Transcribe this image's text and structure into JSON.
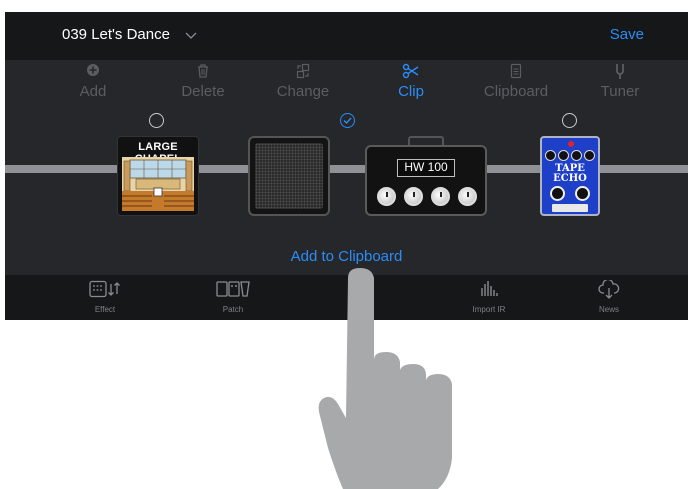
{
  "header": {
    "patch_name": "039 Let's Dance",
    "save_label": "Save"
  },
  "toolbar": {
    "items": [
      {
        "label": "Add",
        "icon": "plus-circle-icon",
        "active": false
      },
      {
        "label": "Delete",
        "icon": "trash-icon",
        "active": false
      },
      {
        "label": "Change",
        "icon": "swap-icon",
        "active": false
      },
      {
        "label": "Clip",
        "icon": "scissors-icon",
        "active": true
      },
      {
        "label": "Clipboard",
        "icon": "clipboard-icon",
        "active": false
      },
      {
        "label": "Tuner",
        "icon": "tuning-fork-icon",
        "active": false
      }
    ]
  },
  "chain": {
    "reverb_title": "LARGE CHAPEL",
    "amp_name": "HW 100",
    "pedal_title_line1": "TAPE",
    "pedal_title_line2": "ECHO",
    "selected": [
      false,
      true,
      false
    ]
  },
  "action": {
    "add_to_clipboard_label": "Add to Clipboard"
  },
  "tabbar": {
    "tabs": [
      {
        "label": "Effect",
        "icon": "effect-icon"
      },
      {
        "label": "Patch",
        "icon": "patch-icon"
      },
      {
        "label": "",
        "icon": "hidden-tab-icon"
      },
      {
        "label": "Import IR",
        "icon": "import-ir-icon"
      },
      {
        "label": "News",
        "icon": "cloud-download-icon"
      }
    ]
  },
  "colors": {
    "accent": "#2a8df7",
    "background": "#26272b",
    "bar": "#161719",
    "inactive": "#5b5d63"
  }
}
